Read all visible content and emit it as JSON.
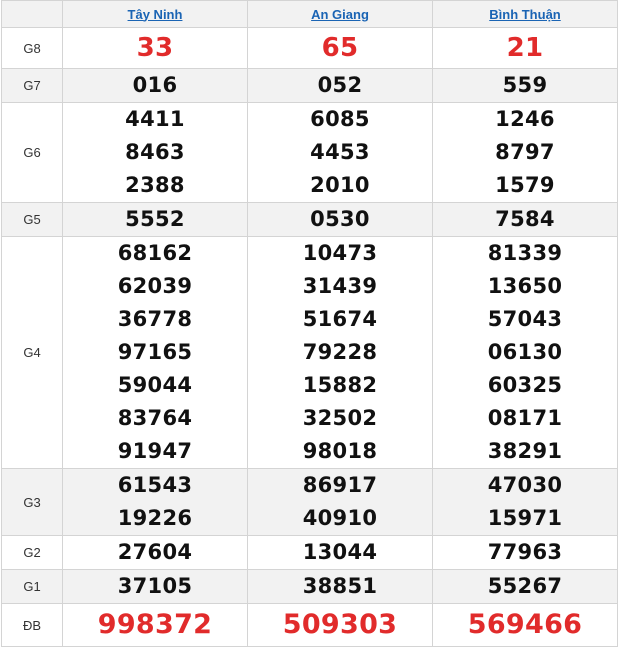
{
  "provinces": [
    "Tây Ninh",
    "An Giang",
    "Bình Thuận"
  ],
  "colors": {
    "highlight": "#e12b2b",
    "link": "#1a64b4",
    "alt_row": "#f2f2f2"
  },
  "prizes": [
    {
      "label": "G8",
      "values": [
        [
          "33"
        ],
        [
          "65"
        ],
        [
          "21"
        ]
      ]
    },
    {
      "label": "G7",
      "values": [
        [
          "016"
        ],
        [
          "052"
        ],
        [
          "559"
        ]
      ]
    },
    {
      "label": "G6",
      "values": [
        [
          "4411",
          "8463",
          "2388"
        ],
        [
          "6085",
          "4453",
          "2010"
        ],
        [
          "1246",
          "8797",
          "1579"
        ]
      ]
    },
    {
      "label": "G5",
      "values": [
        [
          "5552"
        ],
        [
          "0530"
        ],
        [
          "7584"
        ]
      ]
    },
    {
      "label": "G4",
      "values": [
        [
          "68162",
          "62039",
          "36778",
          "97165",
          "59044",
          "83764",
          "91947"
        ],
        [
          "10473",
          "31439",
          "51674",
          "79228",
          "15882",
          "32502",
          "98018"
        ],
        [
          "81339",
          "13650",
          "57043",
          "06130",
          "60325",
          "08171",
          "38291"
        ]
      ]
    },
    {
      "label": "G3",
      "values": [
        [
          "61543",
          "19226"
        ],
        [
          "86917",
          "40910"
        ],
        [
          "47030",
          "15971"
        ]
      ]
    },
    {
      "label": "G2",
      "values": [
        [
          "27604"
        ],
        [
          "13044"
        ],
        [
          "77963"
        ]
      ]
    },
    {
      "label": "G1",
      "values": [
        [
          "37105"
        ],
        [
          "38851"
        ],
        [
          "55267"
        ]
      ]
    },
    {
      "label": "ĐB",
      "values": [
        [
          "998372"
        ],
        [
          "509303"
        ],
        [
          "569466"
        ]
      ]
    }
  ]
}
